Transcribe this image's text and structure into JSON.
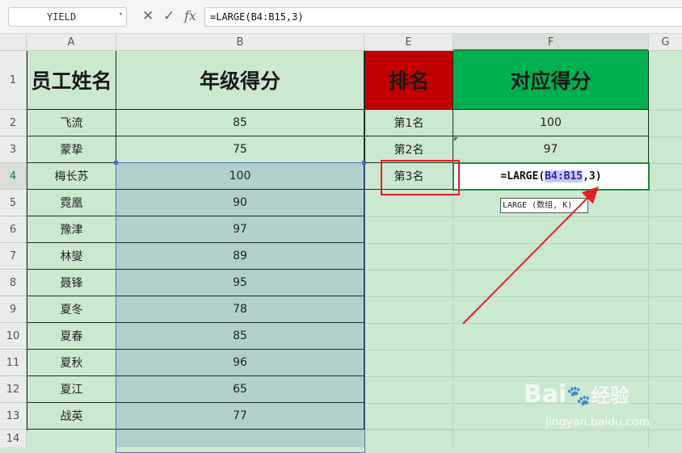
{
  "formula_bar": {
    "name_box": "YIELD",
    "cancel_icon": "✕",
    "confirm_icon": "✓",
    "fx_label": "fx",
    "formula": "=LARGE(B4:B15,3)"
  },
  "columns": [
    "A",
    "B",
    "E",
    "F",
    "G"
  ],
  "rows": [
    "1",
    "2",
    "3",
    "4",
    "5",
    "6",
    "7",
    "8",
    "9",
    "10",
    "11",
    "12",
    "13",
    "14"
  ],
  "headers": {
    "name": "员工姓名",
    "score": "年级得分",
    "rank": "排名",
    "rank_score": "对应得分"
  },
  "data_rows": [
    {
      "name": "飞流",
      "score": "85"
    },
    {
      "name": "蒙挚",
      "score": "75"
    },
    {
      "name": "梅长苏",
      "score": "100"
    },
    {
      "name": "霓凰",
      "score": "90"
    },
    {
      "name": "豫津",
      "score": "97"
    },
    {
      "name": "林燮",
      "score": "89"
    },
    {
      "name": "聂锋",
      "score": "95"
    },
    {
      "name": "夏冬",
      "score": "78"
    },
    {
      "name": "夏春",
      "score": "85"
    },
    {
      "name": "夏秋",
      "score": "96"
    },
    {
      "name": "夏江",
      "score": "65"
    },
    {
      "name": "战英",
      "score": "77"
    }
  ],
  "rank_rows": [
    {
      "rank": "第1名",
      "value": "100"
    },
    {
      "rank": "第2名",
      "value": "97"
    },
    {
      "rank": "第3名",
      "value": ""
    }
  ],
  "edit_cell": {
    "prefix": "=LARGE(",
    "ref": "B4:B15",
    "suffix": ",3)"
  },
  "tooltip": "LARGE (数组, K)",
  "watermark": {
    "brand": "Bai",
    "brand_tail": "经验",
    "url": "jingyan.baidu.com"
  },
  "colors": {
    "sheet_bg": "#cce8cf",
    "rank_header": "#c00000",
    "rank_score_header": "#00b050",
    "selection": "#b3cfcc",
    "annotation_red": "#e02020"
  }
}
